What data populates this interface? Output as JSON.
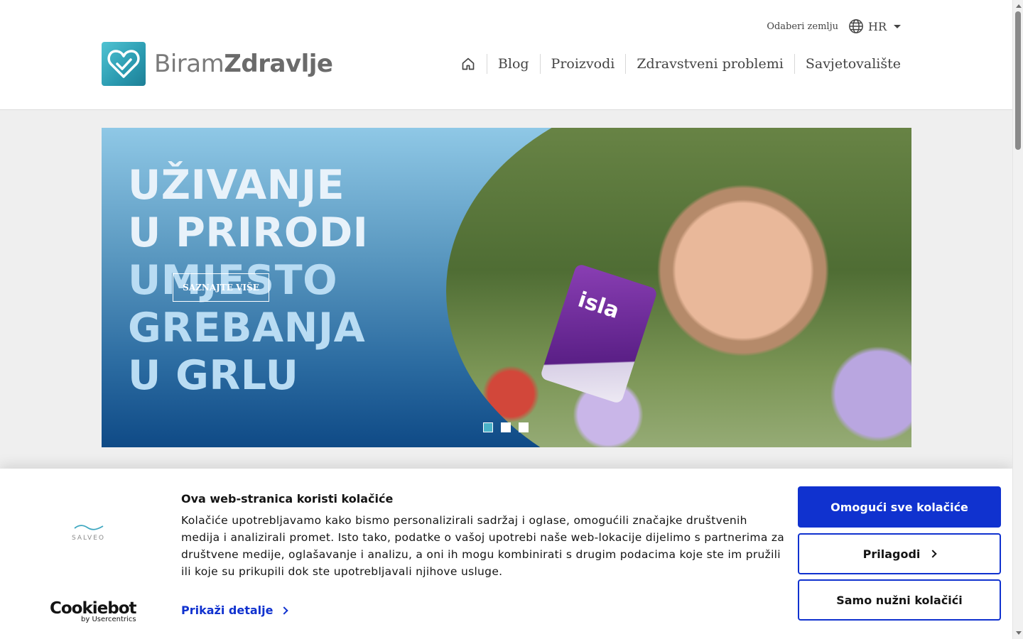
{
  "header": {
    "country_label": "Odaberi zemlju",
    "language": "HR",
    "logo_text_light": "Biram",
    "logo_text_bold": "Zdravlje",
    "nav": [
      "Blog",
      "Proizvodi",
      "Zdravstveni problemi",
      "Savjetovalište"
    ]
  },
  "hero": {
    "title_lines": [
      "UŽIVANJE",
      "U PRIRODI",
      "UMJESTO",
      "GREBANJA",
      "U GRLU"
    ],
    "cta": "SAZNAJTE VIŠE",
    "product_brand": "isla",
    "slide_count": 3,
    "active_slide": 1
  },
  "cookie": {
    "logo": "SALVEO",
    "title": "Ova web-stranica koristi kolačiće",
    "text": "Kolačiće upotrebljavamo kako bismo personalizirali sadržaj i oglase, omogućili značajke društvenih medija i analizirali promet. Isto tako, podatke o vašoj upotrebi naše web-lokacije dijelimo s partnerima za društvene medije, oglašavanje i analizu, a oni ih mogu kombinirati s drugim podacima koje ste im pružili ili koje su prikupili dok ste upotrebljavali njihove usluge.",
    "details_link": "Prikaži detalje",
    "btn_allow_all": "Omogući sve kolačiće",
    "btn_customize": "Prilagodi",
    "btn_necessary": "Samo nužni kolačići",
    "cookiebot_name": "Cookiebot",
    "cookiebot_sub": "by Usercentrics"
  },
  "colors": {
    "accent_blue": "#1032cf",
    "brand_teal": "#4ab2c8"
  }
}
